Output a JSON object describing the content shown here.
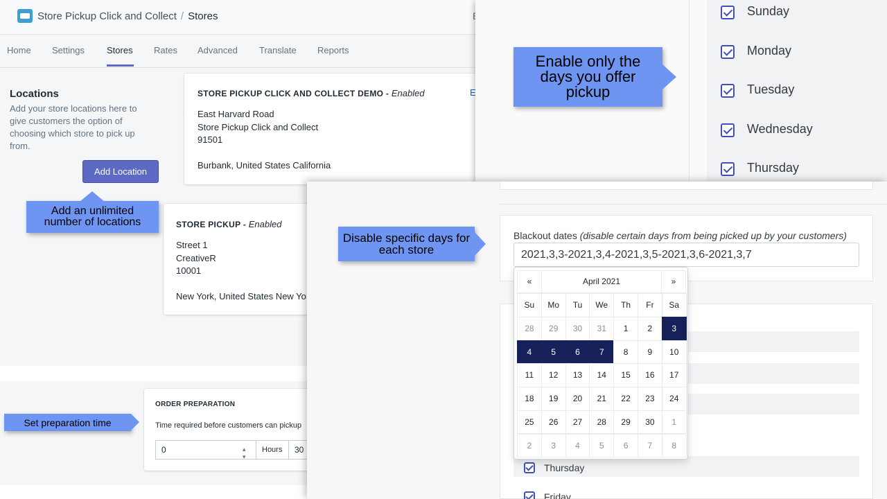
{
  "header": {
    "app_name": "Store Pickup Click and Collect",
    "separator": "/",
    "current_page": "Stores",
    "right_fragment": "E"
  },
  "tabs": [
    {
      "label": "Home"
    },
    {
      "label": "Settings"
    },
    {
      "label": "Stores"
    },
    {
      "label": "Rates"
    },
    {
      "label": "Advanced"
    },
    {
      "label": "Translate"
    },
    {
      "label": "Reports"
    }
  ],
  "locations": {
    "title": "Locations",
    "description": "Add your store locations here to give customers the option of choosing which store to pick up from.",
    "add_button": "Add Location",
    "edit_link": "E"
  },
  "stores": [
    {
      "name": "STORE PICKUP CLICK AND COLLECT DEMO",
      "dash": " - ",
      "status": "Enabled",
      "lines": [
        "East Harvard Road",
        "Store Pickup Click and Collect",
        "91501",
        "",
        "Burbank, United States California"
      ]
    },
    {
      "name": "STORE PICKUP",
      "dash": " - ",
      "status": "Enabled",
      "lines": [
        "Street 1",
        "CreativeR",
        "10001",
        "",
        "New York, United States New Yo"
      ]
    }
  ],
  "order_prep": {
    "title": "ORDER PREPARATION",
    "description": "Time required before customers can pickup",
    "value": "0",
    "unit_label": "Hours",
    "second_value": "30"
  },
  "weekdays": [
    {
      "label": "Sunday",
      "checked": true
    },
    {
      "label": "Monday",
      "checked": true
    },
    {
      "label": "Tuesday",
      "checked": true
    },
    {
      "label": "Wednesday",
      "checked": true
    },
    {
      "label": "Thursday",
      "checked": true
    }
  ],
  "blackout": {
    "label": "Blackout dates",
    "hint": "(disable certain days from being picked up by your customers)",
    "value": "2021,3,3-2021,3,4-2021,3,5-2021,3,6-2021,3,7"
  },
  "lower_days": [
    {
      "label": "Thursday",
      "checked": true
    },
    {
      "label": "Friday",
      "checked": true
    }
  ],
  "datepicker": {
    "prev": "«",
    "next": "»",
    "month_label": "April 2021",
    "dow": [
      "Su",
      "Mo",
      "Tu",
      "We",
      "Th",
      "Fr",
      "Sa"
    ],
    "weeks": [
      [
        "28",
        "29",
        "30",
        "31",
        "1",
        "2",
        "3"
      ],
      [
        "4",
        "5",
        "6",
        "7",
        "8",
        "9",
        "10"
      ],
      [
        "11",
        "12",
        "13",
        "14",
        "15",
        "16",
        "17"
      ],
      [
        "18",
        "19",
        "20",
        "21",
        "22",
        "23",
        "24"
      ],
      [
        "25",
        "26",
        "27",
        "28",
        "29",
        "30",
        "1"
      ],
      [
        "2",
        "3",
        "4",
        "5",
        "6",
        "7",
        "8"
      ]
    ],
    "outside_month": [
      [
        0,
        0
      ],
      [
        0,
        1
      ],
      [
        0,
        2
      ],
      [
        0,
        3
      ],
      [
        4,
        6
      ],
      [
        5,
        0
      ],
      [
        5,
        1
      ],
      [
        5,
        2
      ],
      [
        5,
        3
      ],
      [
        5,
        4
      ],
      [
        5,
        5
      ],
      [
        5,
        6
      ]
    ],
    "selected": [
      [
        0,
        6
      ],
      [
        1,
        0
      ],
      [
        1,
        1
      ],
      [
        1,
        2
      ],
      [
        1,
        3
      ]
    ]
  },
  "callouts": {
    "days": "Enable only the days you offer pickup",
    "locations": "Add an unlimited number of locations",
    "blackout": "Disable specific days for each store",
    "prep": "Set preparation time"
  },
  "colors": {
    "primary_button": "#5c6ac4",
    "callout_bg": "#6f95f3",
    "selected_date": "#16215a",
    "checkbox": "#3f51b5"
  }
}
